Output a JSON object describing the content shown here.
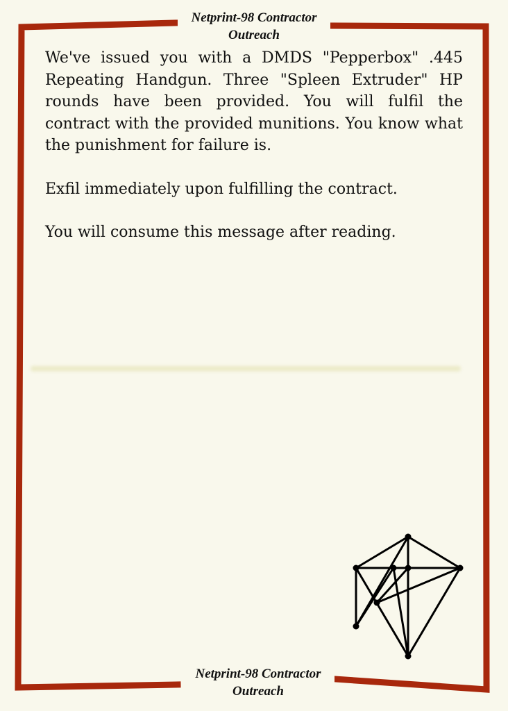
{
  "header": {
    "title": "Netprint-98 Contractor\nOutreach"
  },
  "footer": {
    "title": "Netprint-98 Contractor\nOutreach"
  },
  "message": {
    "paragraph_1": "We've issued you with a DMDS \"Pepperbox\" .445 Repeating Handgun. Three \"Spleen Extruder\" HP rounds have been provided. You will fulfil the contract with the provided munitions. You know what the punishment for failure is.",
    "paragraph_2": "Exfil immediately upon fulfilling the contract.",
    "paragraph_3": "You will consume this message after reading."
  },
  "colors": {
    "border": "#a8280c",
    "background": "#f9f8ec",
    "text": "#111111"
  },
  "icons": {
    "sigil": "geometric-sigil-icon"
  }
}
